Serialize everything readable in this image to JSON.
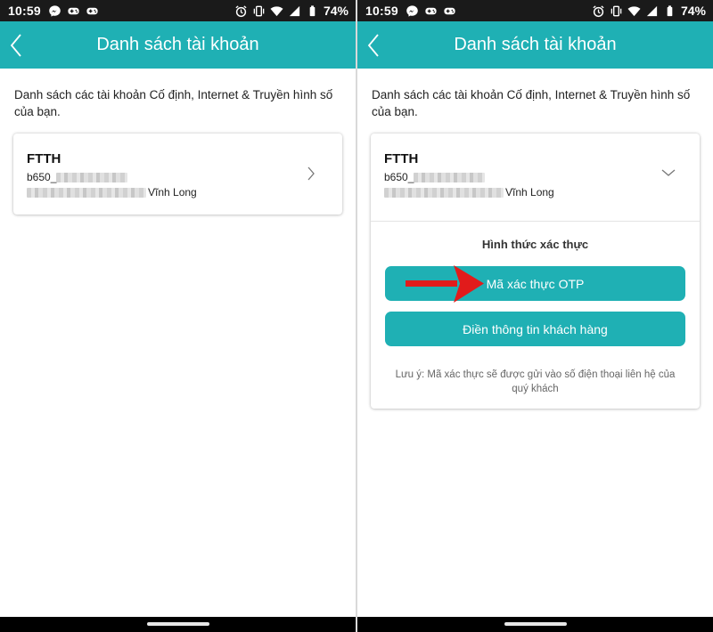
{
  "status": {
    "time": "10:59",
    "battery": "74%"
  },
  "icons": {
    "messenger": "messenger-icon",
    "game": "gamepad-icon",
    "alarm": "alarm-icon",
    "vibrate": "vibrate-icon",
    "wifi": "wifi-icon",
    "signal": "signal-icon",
    "battery": "battery-icon",
    "back": "chevron-left-icon",
    "chevron_right": "chevron-right-icon",
    "chevron_down": "chevron-down-icon",
    "arrow": "red-arrow-icon"
  },
  "colors": {
    "accent": "#1fb0b4",
    "statusbar": "#1a1a1a",
    "arrow": "#e11b1b"
  },
  "left": {
    "title": "Danh sách tài khoản",
    "intro": "Danh sách các tài khoản Cố định, Internet & Truyền hình số của bạn.",
    "account": {
      "type": "FTTH",
      "id_prefix": "b650_",
      "location": "Vĩnh Long"
    }
  },
  "right": {
    "title": "Danh sách tài khoản",
    "intro": "Danh sách các tài khoản Cố định, Internet & Truyền hình số của bạn.",
    "account": {
      "type": "FTTH",
      "id_prefix": "b650_",
      "location": "Vĩnh Long"
    },
    "verify_title": "Hình thức xác thực",
    "otp_button": "Mã xác thực OTP",
    "info_button": "Điền thông tin khách hàng",
    "note": "Lưu ý: Mã xác thực sẽ được gửi vào số điện thoại liên hệ của quý khách"
  }
}
